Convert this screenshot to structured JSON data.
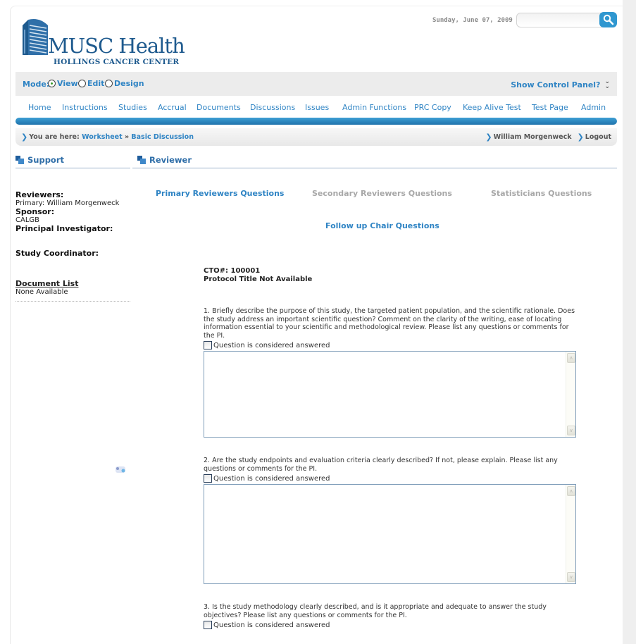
{
  "header": {
    "brand_name": "MUSC Health",
    "brand_subtitle": "HOLLINGS CANCER CENTER",
    "date": "Sunday, June 07, 2009",
    "search_placeholder": "",
    "search_icon": "magnifier-icon"
  },
  "mode_bar": {
    "label": "Mode:",
    "options": [
      {
        "label": "View",
        "selected": true
      },
      {
        "label": "Edit",
        "selected": false
      },
      {
        "label": "Design",
        "selected": false
      }
    ],
    "control_panel_label": "Show Control Panel?",
    "control_panel_icon": "double-chevron-down-icon"
  },
  "nav": {
    "items": [
      "Home",
      "Instructions",
      "Studies",
      "Accrual",
      "Documents",
      "Discussions",
      "Issues",
      "Admin Functions",
      "PRC Copy",
      "Keep Alive Test",
      "Test Page",
      "Admin"
    ]
  },
  "breadcrumb": {
    "prefix": "You are here:",
    "items": [
      "Worksheet",
      "Basic Discussion"
    ],
    "separator": "»",
    "user_name": "William Morgenweck",
    "logout_label": "Logout"
  },
  "sections": {
    "support": "Support",
    "reviewer": "Reviewer"
  },
  "sidebar": {
    "reviewers_label": "Reviewers:",
    "reviewers_value": "Primary: William Morgenweck",
    "sponsor_label": "Sponsor:",
    "sponsor_value": "CALGB",
    "pi_label": "Principal Investigator:",
    "pi_value": "",
    "coordinator_label": "Study Coordinator:",
    "coordinator_value": "",
    "document_list_label": "Document List",
    "document_list_value": "None Available"
  },
  "question_tabs": [
    {
      "label": "Primary Reviewers Questions",
      "active": true
    },
    {
      "label": "Secondary Reviewers Questions",
      "active": false
    },
    {
      "label": "Statisticians Questions",
      "active": false
    },
    {
      "label": "Follow up Chair Questions",
      "active": true
    }
  ],
  "main": {
    "cto": "CTO#: 100001",
    "protocol_title": "Protocol Title Not Available",
    "answered_label": "Question is considered answered",
    "questions": [
      {
        "text": "1. Briefly describe the purpose of this study, the targeted patient population, and the scientific rationale. Does the study address an important scientific question? Comment on the clarity of the writing, ease of locating information essential to your scientific and methodological review. Please list any questions or comments for the PI.",
        "answered": false,
        "answer": ""
      },
      {
        "text": "2. Are the study endpoints and evaluation criteria clearly described? If not, please explain. Please list any questions or comments for the PI.",
        "answered": false,
        "answer": ""
      },
      {
        "text": "3. Is the study methodology clearly described, and is it appropriate and adequate to answer the study objectives? Please list any questions or comments for the PI.",
        "answered": false,
        "answer": ""
      }
    ]
  }
}
